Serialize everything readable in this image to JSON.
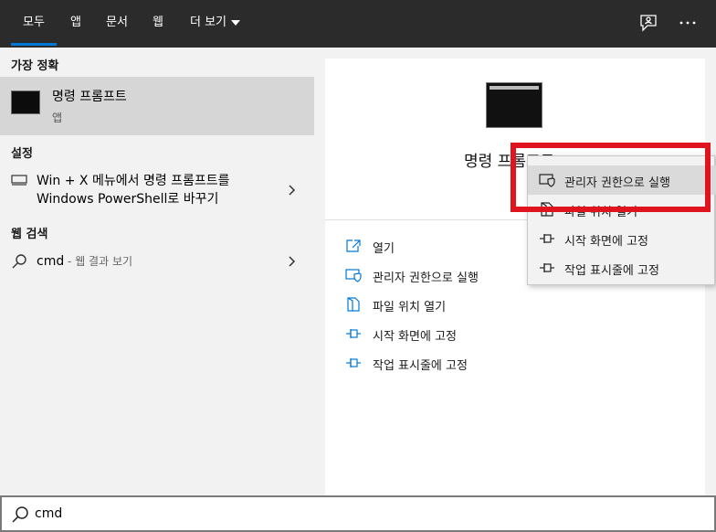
{
  "tabs": [
    {
      "label": "모두",
      "active": true
    },
    {
      "label": "앱"
    },
    {
      "label": "문서"
    },
    {
      "label": "웹"
    },
    {
      "label": "더 보기"
    }
  ],
  "top_icons": [
    "feedback-icon",
    "more-icon"
  ],
  "left": {
    "best_match_header": "가장 정확",
    "best_match": {
      "title": "명령 프롬프트",
      "subtitle": "앱"
    },
    "settings_header": "설정",
    "settings_item": {
      "line1": "Win + X 메뉴에서 명령 프롬프트를",
      "line2": "Windows PowerShell로 바꾸기"
    },
    "web_header": "웹 검색",
    "web_item": {
      "query": "cmd",
      "suffix": " - 웹 결과 보기"
    }
  },
  "right": {
    "app_title": "명령 프롬프트",
    "actions": [
      {
        "label": "열기",
        "icon": "open-icon"
      },
      {
        "label": "관리자 권한으로 실행",
        "icon": "shield-icon"
      },
      {
        "label": "파일 위치 열기",
        "icon": "file-location-icon"
      },
      {
        "label": "시작 화면에 고정",
        "icon": "pin-icon"
      },
      {
        "label": "작업 표시줄에 고정",
        "icon": "pin-icon"
      }
    ]
  },
  "context_menu": {
    "items": [
      {
        "label": "관리자 권한으로 실행",
        "icon": "shield-icon",
        "highlighted": true
      },
      {
        "label": "파일 위치 열기",
        "icon": "file-location-icon"
      },
      {
        "label": "시작 화면에 고정",
        "icon": "pin-icon"
      },
      {
        "label": "작업 표시줄에 고정",
        "icon": "pin-icon"
      }
    ]
  },
  "search": {
    "value": "cmd"
  },
  "colors": {
    "accent": "#0078d7",
    "annotation_red": "#e0141e",
    "topbar": "#2b2b2b"
  }
}
